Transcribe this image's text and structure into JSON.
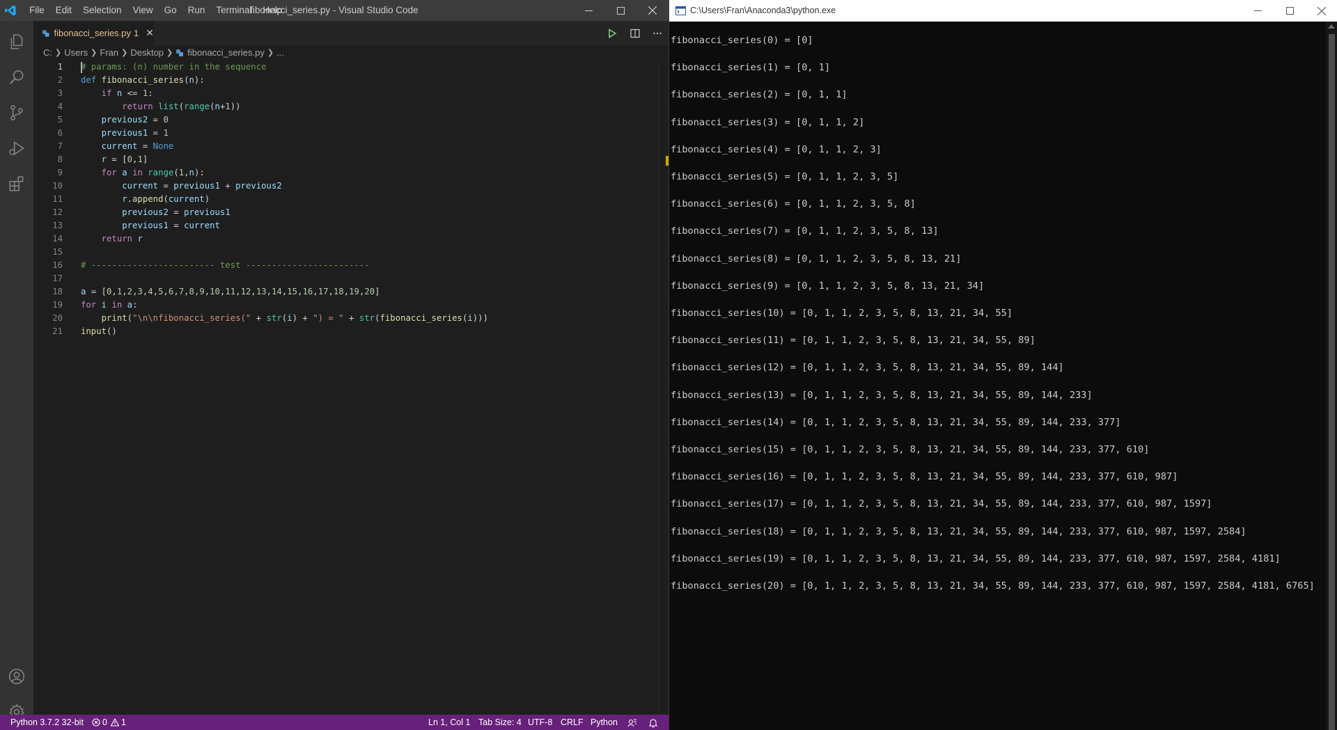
{
  "vscode": {
    "window_title": "fibonacci_series.py - Visual Studio Code",
    "menu": [
      "File",
      "Edit",
      "Selection",
      "View",
      "Go",
      "Run",
      "Terminal",
      "Help"
    ],
    "tab": {
      "filename": "fibonacci_series.py",
      "problem_count": "1",
      "close": "✕"
    },
    "breadcrumb": [
      "C:",
      "Users",
      "Fran",
      "Desktop",
      "fibonacci_series.py",
      "..."
    ],
    "line_numbers": [
      "1",
      "2",
      "3",
      "4",
      "5",
      "6",
      "7",
      "8",
      "9",
      "10",
      "11",
      "12",
      "13",
      "14",
      "15",
      "16",
      "17",
      "18",
      "19",
      "20",
      "21"
    ],
    "code_lines": [
      "# params: (n) number in the sequence",
      "def fibonacci_series(n):",
      "    if n <= 1:",
      "        return list(range(n+1))",
      "    previous2 = 0",
      "    previous1 = 1",
      "    current = None",
      "    r = [0,1]",
      "    for a in range(1,n):",
      "        current = previous1 + previous2",
      "        r.append(current)",
      "        previous2 = previous1",
      "        previous1 = current",
      "    return r",
      "",
      "# ------------------------ test ------------------------",
      "",
      "a = [0,1,2,3,4,5,6,7,8,9,10,11,12,13,14,15,16,17,18,19,20]",
      "for i in a:",
      "    print(\"\\n\\nfibonacci_series(\" + str(i) + \") = \" + str(fibonacci_series(i)))",
      "input()"
    ],
    "statusbar": {
      "interpreter": "Python 3.7.2 32-bit",
      "errors": "0",
      "warnings": "1",
      "position": "Ln 1, Col 1",
      "tab_size": "Tab Size: 4",
      "encoding": "UTF-8",
      "eol": "CRLF",
      "language": "Python"
    },
    "colors": {
      "statusbar": "#68217a",
      "titlebar": "#3c3c3c",
      "activitybar": "#333333",
      "editor_bg": "#1e1e1e"
    }
  },
  "console": {
    "title": "C:\\Users\\Fran\\Anaconda3\\python.exe",
    "output": [
      "fibonacci_series(0) = [0]",
      "fibonacci_series(1) = [0, 1]",
      "fibonacci_series(2) = [0, 1, 1]",
      "fibonacci_series(3) = [0, 1, 1, 2]",
      "fibonacci_series(4) = [0, 1, 1, 2, 3]",
      "fibonacci_series(5) = [0, 1, 1, 2, 3, 5]",
      "fibonacci_series(6) = [0, 1, 1, 2, 3, 5, 8]",
      "fibonacci_series(7) = [0, 1, 1, 2, 3, 5, 8, 13]",
      "fibonacci_series(8) = [0, 1, 1, 2, 3, 5, 8, 13, 21]",
      "fibonacci_series(9) = [0, 1, 1, 2, 3, 5, 8, 13, 21, 34]",
      "fibonacci_series(10) = [0, 1, 1, 2, 3, 5, 8, 13, 21, 34, 55]",
      "fibonacci_series(11) = [0, 1, 1, 2, 3, 5, 8, 13, 21, 34, 55, 89]",
      "fibonacci_series(12) = [0, 1, 1, 2, 3, 5, 8, 13, 21, 34, 55, 89, 144]",
      "fibonacci_series(13) = [0, 1, 1, 2, 3, 5, 8, 13, 21, 34, 55, 89, 144, 233]",
      "fibonacci_series(14) = [0, 1, 1, 2, 3, 5, 8, 13, 21, 34, 55, 89, 144, 233, 377]",
      "fibonacci_series(15) = [0, 1, 1, 2, 3, 5, 8, 13, 21, 34, 55, 89, 144, 233, 377, 610]",
      "fibonacci_series(16) = [0, 1, 1, 2, 3, 5, 8, 13, 21, 34, 55, 89, 144, 233, 377, 610, 987]",
      "fibonacci_series(17) = [0, 1, 1, 2, 3, 5, 8, 13, 21, 34, 55, 89, 144, 233, 377, 610, 987, 1597]",
      "fibonacci_series(18) = [0, 1, 1, 2, 3, 5, 8, 13, 21, 34, 55, 89, 144, 233, 377, 610, 987, 1597, 2584]",
      "fibonacci_series(19) = [0, 1, 1, 2, 3, 5, 8, 13, 21, 34, 55, 89, 144, 233, 377, 610, 987, 1597, 2584, 4181]",
      "fibonacci_series(20) = [0, 1, 1, 2, 3, 5, 8, 13, 21, 34, 55, 89, 144, 233, 377, 610, 987, 1597, 2584, 4181, 6765]"
    ]
  }
}
